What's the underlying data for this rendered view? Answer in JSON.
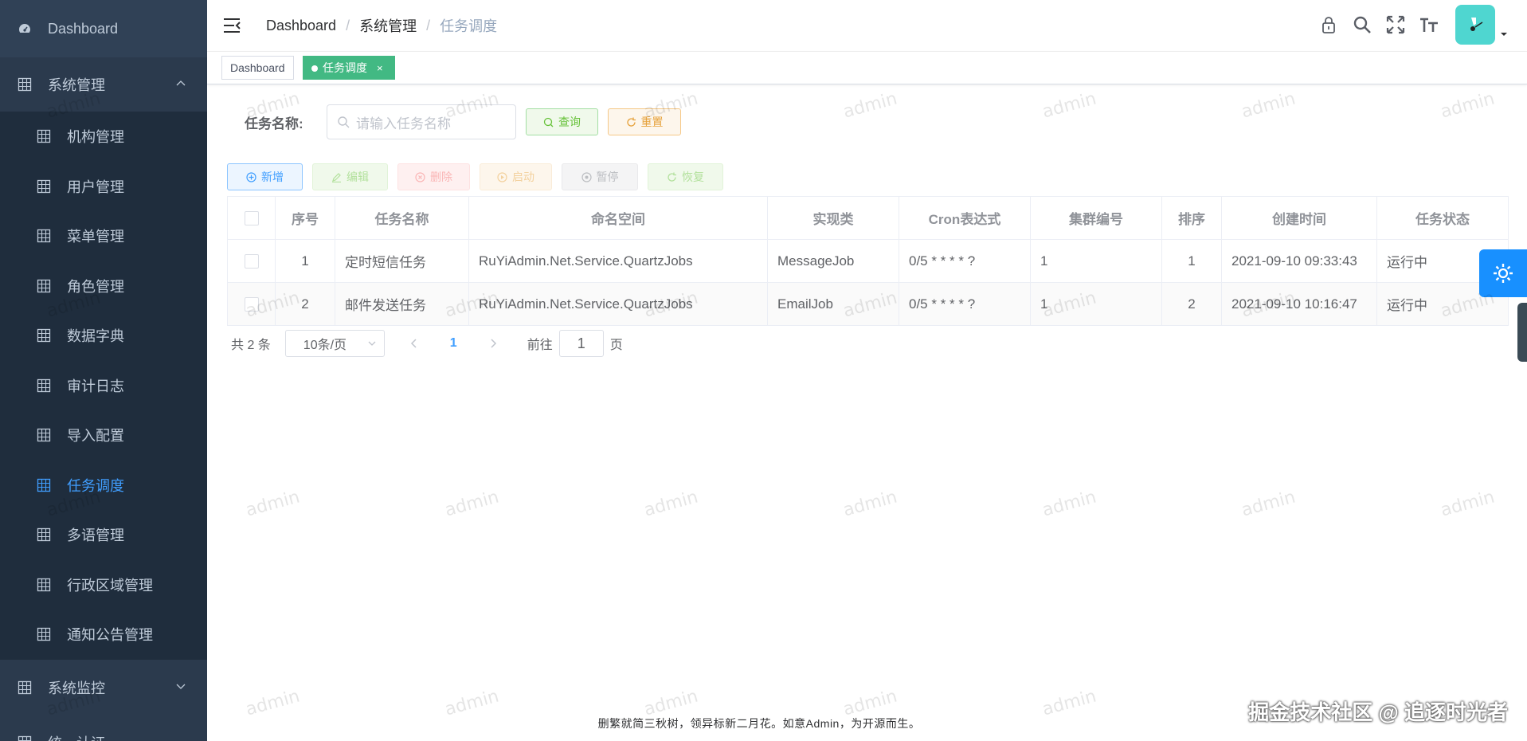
{
  "sidebar": {
    "top_item": "Dashboard",
    "group1": "系统管理",
    "items": [
      {
        "label": "机构管理",
        "active": false
      },
      {
        "label": "用户管理",
        "active": false
      },
      {
        "label": "菜单管理",
        "active": false
      },
      {
        "label": "角色管理",
        "active": false
      },
      {
        "label": "数据字典",
        "active": false
      },
      {
        "label": "审计日志",
        "active": false
      },
      {
        "label": "导入配置",
        "active": false
      },
      {
        "label": "任务调度",
        "active": true
      },
      {
        "label": "多语管理",
        "active": false
      },
      {
        "label": "行政区域管理",
        "active": false
      },
      {
        "label": "通知公告管理",
        "active": false
      }
    ],
    "group2": "系统监控",
    "group3": "统一认证"
  },
  "breadcrumb": {
    "b1": "Dashboard",
    "sep": "/",
    "b2": "系统管理",
    "b3": "任务调度"
  },
  "tags": [
    {
      "label": "Dashboard"
    },
    {
      "label": "任务调度",
      "close": "×"
    }
  ],
  "search": {
    "label": "任务名称:",
    "placeholder": "请输入任务名称",
    "query_btn": "查询",
    "reset_btn": "重置"
  },
  "toolbar": {
    "add": "新增",
    "edit": "编辑",
    "delete": "删除",
    "start": "启动",
    "pause": "暂停",
    "resume": "恢复"
  },
  "table": {
    "headers": [
      "序号",
      "任务名称",
      "命名空间",
      "实现类",
      "Cron表达式",
      "集群编号",
      "排序",
      "创建时间",
      "任务状态"
    ],
    "rows": [
      [
        "1",
        "定时短信任务",
        "RuYiAdmin.Net.Service.QuartzJobs",
        "MessageJob",
        "0/5 * * * * ?",
        "1",
        "1",
        "2021-09-10 09:33:43",
        "运行中"
      ],
      [
        "2",
        "邮件发送任务",
        "RuYiAdmin.Net.Service.QuartzJobs",
        "EmailJob",
        "0/5 * * * * ?",
        "1",
        "2",
        "2021-09-10 10:16:47",
        "运行中"
      ]
    ]
  },
  "pager": {
    "total": "共 2 条",
    "size": "10条/页",
    "current": "1",
    "goto_prefix": "前往",
    "goto_value": "1",
    "goto_suffix": "页"
  },
  "footer": "删繁就简三秋树，领异标新二月花。如意Admin，为开源而生。",
  "overlay": "掘金技术社区 @ 追逐时光者",
  "watermark": "admin",
  "colors": {
    "sidebar_bg": "#304156",
    "active": "#409eff",
    "tag_active": "#42b983",
    "settings": "#1890ff"
  }
}
